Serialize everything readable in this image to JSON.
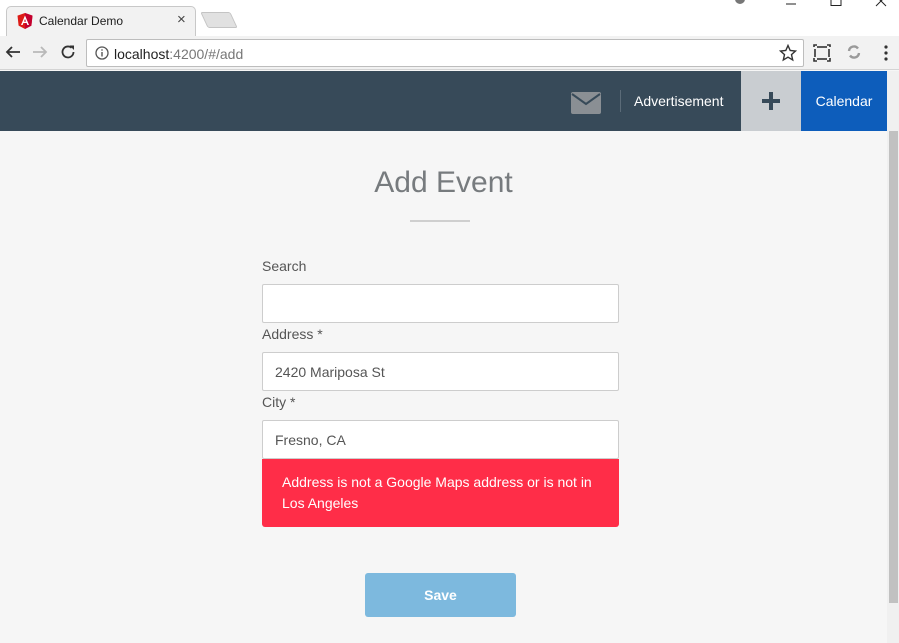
{
  "browser": {
    "tab_title": "Calendar Demo",
    "tab_close": "×",
    "url_host": "localhost",
    "url_path": ":4200/#/add"
  },
  "navbar": {
    "advertisement": "Advertisement",
    "add": "+",
    "calendar": "Calendar"
  },
  "form": {
    "title": "Add Event",
    "search_label": "Search",
    "search_value": "",
    "address_label": "Address *",
    "address_value": "2420 Mariposa St",
    "city_label": "City *",
    "city_value": "Fresno, CA",
    "error": "Address is not a Google Maps address or is not in Los Angeles",
    "save_label": "Save"
  },
  "colors": {
    "navbar_bg": "#374a59",
    "calendar_bg": "#0d5dbb",
    "error_bg": "#ff2d48",
    "save_bg": "#7db9de"
  }
}
